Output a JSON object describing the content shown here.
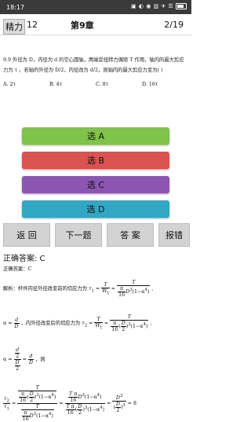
{
  "status": {
    "time": "18:17",
    "icons": "▣ ◐ ◉ ▥ ✈ ☰"
  },
  "header": {
    "subject": "精力",
    "chapter_num": "12",
    "chapter_title": "第9章",
    "page": "2/19"
  },
  "question": {
    "text": "9.9  外径为 D，内径为 d 的空心圆轴，两端受扭转力偶矩 T 作用，轴内的最大剪应力为 τ 。若轴的外径为 D/2，内径改为 d/2，则轴内的最大剪应力变为(    )",
    "options": [
      "A. 2τ",
      "B. 4τ",
      "C. 8τ",
      "D. 16τ"
    ]
  },
  "answers": [
    "选 A",
    "选 B",
    "选 C",
    "选 D"
  ],
  "nav": {
    "back": "返 回",
    "next": "下一题",
    "answer": "答 案",
    "report": "报错"
  },
  "result": {
    "correct_label": "正确答案:  C",
    "correct_small": "正确答案：C"
  },
  "analysis": {
    "line1": "解析：杆件内径外径改变前的切应力为",
    "line2_a": "α =",
    "line2_b": "，内外径改变后的切应力为",
    "line3_b": "，则"
  }
}
